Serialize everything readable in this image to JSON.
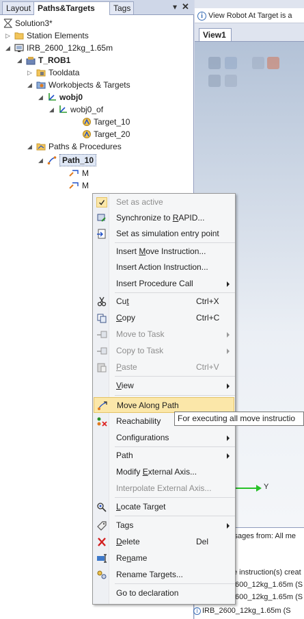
{
  "panel": {
    "tabs": [
      "Layout",
      "Paths&Targets",
      "Tags"
    ],
    "pin": "⩾",
    "close": "✕"
  },
  "tree": {
    "solution": "Solution3*",
    "station_elements": "Station Elements",
    "robot": "IRB_2600_12kg_1.65m",
    "task": "T_ROB1",
    "tooldata": "Tooldata",
    "workobjects": "Workobjects & Targets",
    "wobj0": "wobj0",
    "wobj0_of": "wobj0_of",
    "target10": "Target_10",
    "target20": "Target_20",
    "paths": "Paths & Procedures",
    "path10": "Path_10",
    "child1": "M",
    "child2": "M"
  },
  "right": {
    "info": "View Robot At Target is a",
    "view_tab": "View1",
    "axis_label": "Y",
    "msg_header": "ssages from:  All me",
    "msg_lines": [
      "e instruction(s) creat",
      "600_12kg_1.65m (S",
      "600_12kg_1.65m (S",
      "IRB_2600_12kg_1.65m (S"
    ]
  },
  "menu": {
    "set_active": "Set as active",
    "sync_pre": "Synchronize to ",
    "sync_u": "R",
    "sync_post": "APID...",
    "sim_entry": "Set as simulation entry point",
    "ins_move_pre": "Insert ",
    "ins_move_u": "M",
    "ins_move_post": "ove Instruction...",
    "ins_action": "Insert Action Instruction...",
    "ins_proc": "Insert Procedure Call",
    "cut_pre": "Cu",
    "cut_u": "t",
    "cut_sc": "Ctrl+X",
    "copy_u": "C",
    "copy_post": "opy",
    "copy_sc": "Ctrl+C",
    "move_task": "Move to Task",
    "copy_task": "Copy to Task",
    "paste_u": "P",
    "paste_post": "aste",
    "paste_sc": "Ctrl+V",
    "view_u": "V",
    "view_post": "iew",
    "move_along": "Move Along Path",
    "reachability": "Reachability",
    "configurations": "Configurations",
    "path": "Path",
    "modify_ext_pre": "Modify ",
    "modify_ext_u": "E",
    "modify_ext_post": "xternal Axis...",
    "interp_ext": "Interpolate External Axis...",
    "locate_u": "L",
    "locate_post": "ocate Target",
    "tags": "Tags",
    "delete_u": "D",
    "delete_post": "elete",
    "delete_sc": "Del",
    "rename_pre": "Re",
    "rename_u": "n",
    "rename_post": "ame",
    "rename_targets": "Rename Targets...",
    "goto_decl": "Go to declaration"
  },
  "tooltip": "For executing all move instructio",
  "colors": {
    "highlight": "#fbe7a9",
    "axis_green": "#27c127",
    "panel_border": "#8e9bbc"
  }
}
